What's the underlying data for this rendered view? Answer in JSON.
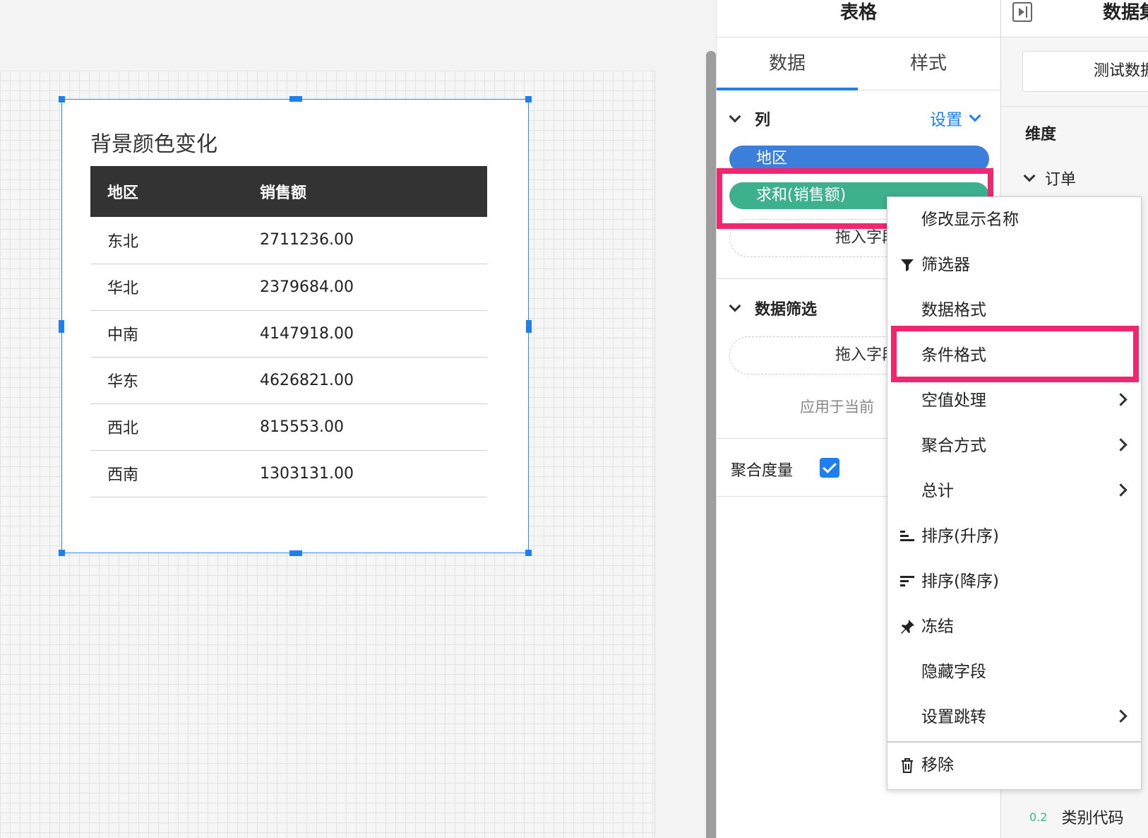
{
  "widget": {
    "title": "背景颜色变化",
    "table": {
      "headers": [
        "地区",
        "销售额"
      ],
      "rows": [
        [
          "东北",
          "2711236.00"
        ],
        [
          "华北",
          "2379684.00"
        ],
        [
          "中南",
          "4147918.00"
        ],
        [
          "华东",
          "4626821.00"
        ],
        [
          "西北",
          "815553.00"
        ],
        [
          "西南",
          "1303131.00"
        ]
      ]
    }
  },
  "panel": {
    "title": "表格",
    "tabs": [
      "数据",
      "样式"
    ],
    "columns_section": "列",
    "settings_link": "设置",
    "fields": [
      "地区",
      "求和(销售额)"
    ],
    "drop_zone": "拖入字段",
    "filter_section": "数据筛选",
    "filter_drop_zone": "拖入字段",
    "apply_note": "应用于当前",
    "aggregate_label": "聚合度量"
  },
  "data_panel": {
    "title": "数据集",
    "test_button": "测试数据",
    "dimension_label": "维度",
    "order_group": "订单",
    "category_code": "类别代码",
    "category_code_type": "0.2"
  },
  "context_menu": {
    "items": [
      {
        "label": "修改显示名称",
        "icon": "none",
        "submenu": false
      },
      {
        "label": "筛选器",
        "icon": "filter-icon",
        "submenu": false
      },
      {
        "label": "数据格式",
        "icon": "none",
        "submenu": false
      },
      {
        "label": "条件格式",
        "icon": "none",
        "submenu": false
      },
      {
        "label": "空值处理",
        "icon": "none",
        "submenu": true
      },
      {
        "label": "聚合方式",
        "icon": "none",
        "submenu": true
      },
      {
        "label": "总计",
        "icon": "none",
        "submenu": true
      },
      {
        "label": "排序(升序)",
        "icon": "sort-ascending-icon",
        "submenu": false
      },
      {
        "label": "排序(降序)",
        "icon": "sort-descending-icon",
        "submenu": false
      },
      {
        "label": "冻结",
        "icon": "pin-icon",
        "submenu": false
      },
      {
        "label": "隐藏字段",
        "icon": "none",
        "submenu": false
      },
      {
        "label": "设置跳转",
        "icon": "none",
        "submenu": true
      },
      {
        "label": "移除",
        "icon": "trash-icon",
        "submenu": false
      }
    ]
  },
  "colors": {
    "accent": "#1e7ff0",
    "dimension_pill": "#3c7fdb",
    "measure_pill": "#3db08e",
    "highlight": "#f0266f",
    "table_header": "#333333"
  }
}
